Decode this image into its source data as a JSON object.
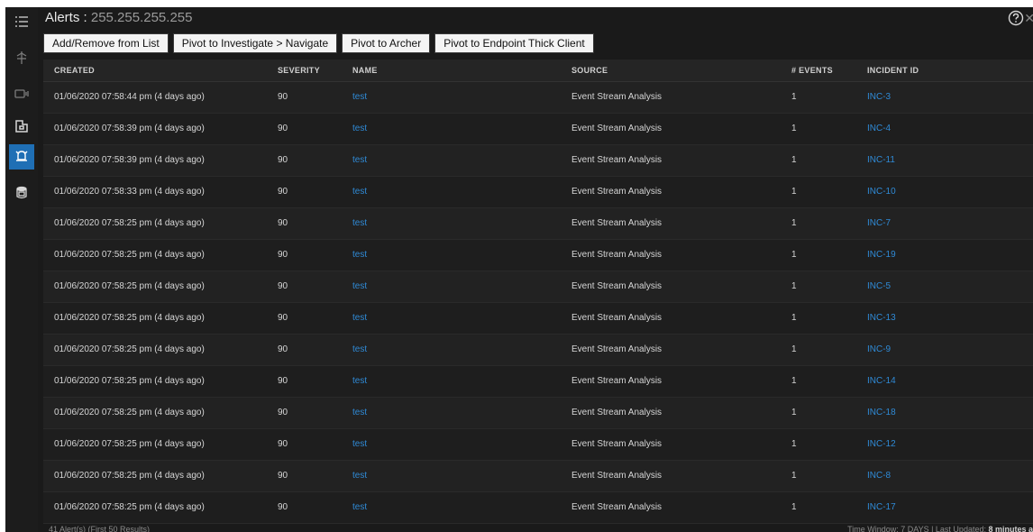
{
  "header": {
    "title_label": "Alerts : ",
    "title_ip": "255.255.255.255"
  },
  "sidebar": {
    "icons": [
      "list-icon",
      "navigate-icon",
      "events-icon",
      "investigate-icon",
      "alerts-icon",
      "database-icon"
    ],
    "active_icon": "alerts-icon"
  },
  "toolbar": {
    "add_remove_label": "Add/Remove from List",
    "pivot_investigate_label": "Pivot to Investigate > Navigate",
    "pivot_archer_label": "Pivot to Archer",
    "pivot_endpoint_label": "Pivot to Endpoint Thick Client"
  },
  "table": {
    "columns": [
      "CREATED",
      "SEVERITY",
      "NAME",
      "SOURCE",
      "# EVENTS",
      "INCIDENT ID"
    ],
    "rows": [
      {
        "created": "01/06/2020 07:58:44 pm (4 days ago)",
        "severity": "90",
        "name": "test",
        "source": "Event Stream Analysis",
        "events": "1",
        "incident": "INC-3"
      },
      {
        "created": "01/06/2020 07:58:39 pm (4 days ago)",
        "severity": "90",
        "name": "test",
        "source": "Event Stream Analysis",
        "events": "1",
        "incident": "INC-4"
      },
      {
        "created": "01/06/2020 07:58:39 pm (4 days ago)",
        "severity": "90",
        "name": "test",
        "source": "Event Stream Analysis",
        "events": "1",
        "incident": "INC-11"
      },
      {
        "created": "01/06/2020 07:58:33 pm (4 days ago)",
        "severity": "90",
        "name": "test",
        "source": "Event Stream Analysis",
        "events": "1",
        "incident": "INC-10"
      },
      {
        "created": "01/06/2020 07:58:25 pm (4 days ago)",
        "severity": "90",
        "name": "test",
        "source": "Event Stream Analysis",
        "events": "1",
        "incident": "INC-7"
      },
      {
        "created": "01/06/2020 07:58:25 pm (4 days ago)",
        "severity": "90",
        "name": "test",
        "source": "Event Stream Analysis",
        "events": "1",
        "incident": "INC-19"
      },
      {
        "created": "01/06/2020 07:58:25 pm (4 days ago)",
        "severity": "90",
        "name": "test",
        "source": "Event Stream Analysis",
        "events": "1",
        "incident": "INC-5"
      },
      {
        "created": "01/06/2020 07:58:25 pm (4 days ago)",
        "severity": "90",
        "name": "test",
        "source": "Event Stream Analysis",
        "events": "1",
        "incident": "INC-13"
      },
      {
        "created": "01/06/2020 07:58:25 pm (4 days ago)",
        "severity": "90",
        "name": "test",
        "source": "Event Stream Analysis",
        "events": "1",
        "incident": "INC-9"
      },
      {
        "created": "01/06/2020 07:58:25 pm (4 days ago)",
        "severity": "90",
        "name": "test",
        "source": "Event Stream Analysis",
        "events": "1",
        "incident": "INC-14"
      },
      {
        "created": "01/06/2020 07:58:25 pm (4 days ago)",
        "severity": "90",
        "name": "test",
        "source": "Event Stream Analysis",
        "events": "1",
        "incident": "INC-18"
      },
      {
        "created": "01/06/2020 07:58:25 pm (4 days ago)",
        "severity": "90",
        "name": "test",
        "source": "Event Stream Analysis",
        "events": "1",
        "incident": "INC-12"
      },
      {
        "created": "01/06/2020 07:58:25 pm (4 days ago)",
        "severity": "90",
        "name": "test",
        "source": "Event Stream Analysis",
        "events": "1",
        "incident": "INC-8"
      },
      {
        "created": "01/06/2020 07:58:25 pm (4 days ago)",
        "severity": "90",
        "name": "test",
        "source": "Event Stream Analysis",
        "events": "1",
        "incident": "INC-17"
      }
    ]
  },
  "footer": {
    "results_summary": "41 Alert(s) (First 50 Results)",
    "time_window": "Time Window: 7 DAYS | Last Updated: ",
    "last_updated": "8 minutes a"
  },
  "colors": {
    "background": "#1a1a1a",
    "accent": "#1f6fb5",
    "link": "#2f8ad6"
  }
}
